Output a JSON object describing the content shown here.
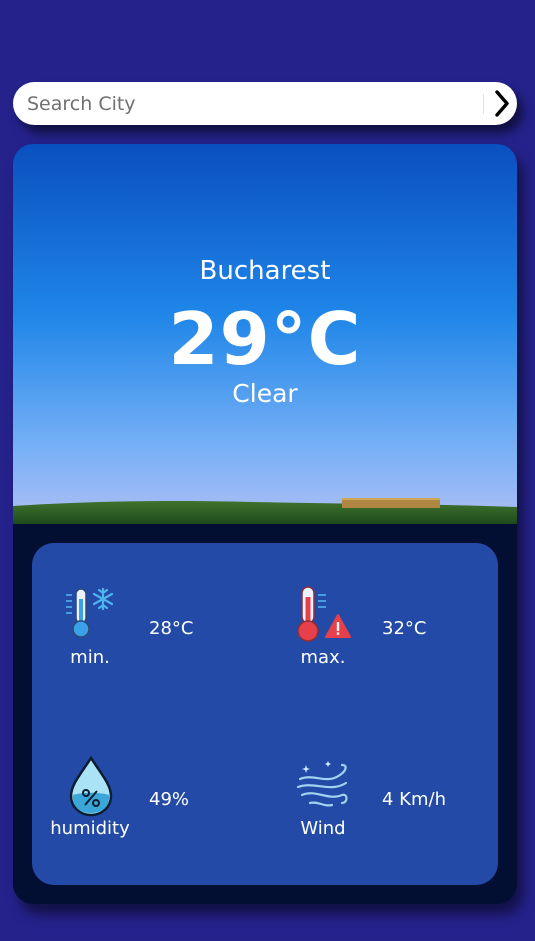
{
  "search": {
    "placeholder": "Search City",
    "button_icon": "chevron-right-icon"
  },
  "weather": {
    "city": "Bucharest",
    "temperature": "29°C",
    "condition": "Clear"
  },
  "details": {
    "min": {
      "label": "min.",
      "value": "28°C",
      "icon": "thermometer-snowflake-icon"
    },
    "max": {
      "label": "max.",
      "value": "32°C",
      "icon": "thermometer-warning-icon"
    },
    "humidity": {
      "label": "humidity",
      "value": "49%",
      "icon": "water-drop-icon"
    },
    "wind": {
      "label": "Wind",
      "value": "4 Km/h",
      "icon": "wind-icon"
    }
  },
  "colors": {
    "page_background": "#25228c",
    "card_background": "#030e33",
    "details_panel": "#234aa6",
    "sky_top": "#0a4fc0",
    "sky_bottom": "#a9c4f7"
  }
}
